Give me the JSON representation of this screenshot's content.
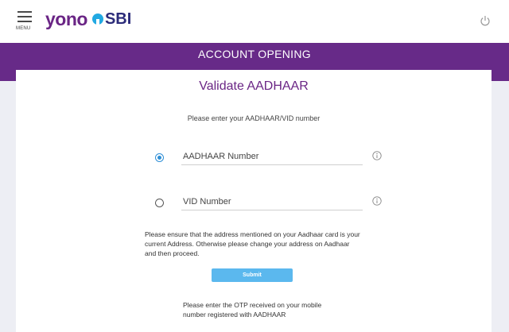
{
  "header": {
    "menu_label": "MENU",
    "brand_yono": "yono",
    "brand_sbi": "SBI"
  },
  "band": {
    "title": "ACCOUNT OPENING"
  },
  "card": {
    "title": "Validate AADHAAR",
    "subtitle": "Please enter your AADHAAR/VID number",
    "options": [
      {
        "placeholder": "AADHAAR Number",
        "selected": true
      },
      {
        "placeholder": "VID Number",
        "selected": false
      }
    ],
    "address_note": "Please ensure that the address mentioned on your Aadhaar card is your current Address. Otherwise please change your address on Aadhaar and then proceed.",
    "submit_label": "Submit",
    "otp_note": "Please enter the OTP received on your mobile number registered with AADHAAR"
  },
  "colors": {
    "brand_purple": "#672a88",
    "accent_blue": "#5bb8ee",
    "sbi_blue": "#22a9e2"
  },
  "icons": [
    "menu-icon",
    "sbi-logo-icon",
    "power-icon",
    "info-icon"
  ]
}
